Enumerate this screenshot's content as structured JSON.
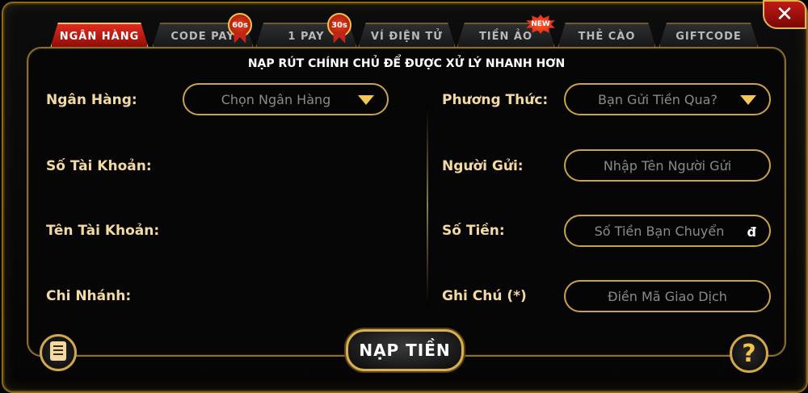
{
  "tabs": [
    {
      "label": "NGÂN HÀNG",
      "active": true
    },
    {
      "label": "CODE PAY",
      "badge": "60s"
    },
    {
      "label": "1 PAY",
      "badge": "30s"
    },
    {
      "label": "VÍ ĐIỆN TỬ"
    },
    {
      "label": "TIỀN ẢO",
      "badge": "NEW"
    },
    {
      "label": "THẺ CÀO"
    },
    {
      "label": "GIFTCODE"
    }
  ],
  "heading": "NẠP RÚT CHÍNH CHỦ ĐỂ ĐƯỢC XỬ LÝ NHANH HƠN",
  "left": {
    "bank_label": "Ngân Hàng:",
    "bank_select": "Chọn Ngân Hàng",
    "account_number_label": "Số Tài Khoản:",
    "account_name_label": "Tên Tài Khoản:",
    "branch_label": "Chi Nhánh:"
  },
  "right": {
    "method_label": "Phương Thức:",
    "method_select": "Bạn Gửi Tiền Qua?",
    "sender_label": "Người Gửi:",
    "sender_placeholder": "Nhập Tên Người Gửi",
    "amount_label": "Số Tiền:",
    "amount_placeholder": "Số Tiền Bạn Chuyển",
    "currency": "đ",
    "note_label": "Ghi Chú (*)",
    "note_placeholder": "Điền Mã Giao Dịch"
  },
  "deposit_button": "NẠP TIỀN",
  "help_button": "?",
  "close_button": "✕",
  "icons": {
    "history": "list-icon",
    "help": "question-icon",
    "close": "close-icon"
  },
  "colors": {
    "accent": "#c9a24c",
    "active_tab": "#d8261a",
    "label": "#f3d9a2"
  }
}
